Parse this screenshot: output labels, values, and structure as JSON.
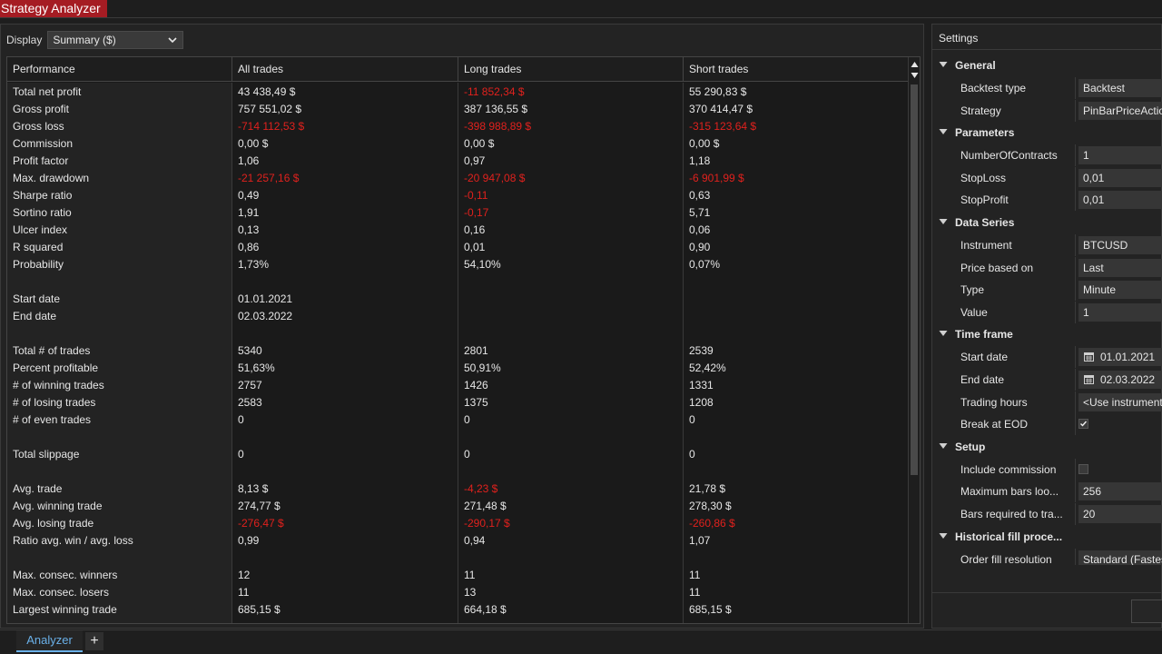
{
  "window": {
    "title": "Strategy Analyzer"
  },
  "display": {
    "label": "Display",
    "selected": "Summary ($)"
  },
  "table": {
    "columns": [
      "Performance",
      "All trades",
      "Long trades",
      "Short trades"
    ],
    "rows": [
      {
        "label": "Total net profit",
        "all": "43 438,49 $",
        "long": "-11 852,34 $",
        "short": "55 290,83 $"
      },
      {
        "label": "Gross profit",
        "all": "757 551,02 $",
        "long": "387 136,55 $",
        "short": "370 414,47 $"
      },
      {
        "label": "Gross loss",
        "all": "-714 112,53 $",
        "long": "-398 988,89 $",
        "short": "-315 123,64 $"
      },
      {
        "label": "Commission",
        "all": "0,00 $",
        "long": "0,00 $",
        "short": "0,00 $"
      },
      {
        "label": "Profit factor",
        "all": "1,06",
        "long": "0,97",
        "short": "1,18"
      },
      {
        "label": "Max. drawdown",
        "all": "-21 257,16 $",
        "long": "-20 947,08 $",
        "short": "-6 901,99 $"
      },
      {
        "label": "Sharpe ratio",
        "all": "0,49",
        "long": "-0,11",
        "short": "0,63"
      },
      {
        "label": "Sortino ratio",
        "all": "1,91",
        "long": "-0,17",
        "short": "5,71"
      },
      {
        "label": "Ulcer index",
        "all": "0,13",
        "long": "0,16",
        "short": "0,06"
      },
      {
        "label": "R squared",
        "all": "0,86",
        "long": "0,01",
        "short": "0,90"
      },
      {
        "label": "Probability",
        "all": "1,73%",
        "long": "54,10%",
        "short": "0,07%"
      },
      {
        "label": "",
        "all": "",
        "long": "",
        "short": ""
      },
      {
        "label": "Start date",
        "all": "01.01.2021",
        "long": "",
        "short": ""
      },
      {
        "label": "End date",
        "all": "02.03.2022",
        "long": "",
        "short": ""
      },
      {
        "label": "",
        "all": "",
        "long": "",
        "short": ""
      },
      {
        "label": "Total # of trades",
        "all": "5340",
        "long": "2801",
        "short": "2539"
      },
      {
        "label": "Percent profitable",
        "all": "51,63%",
        "long": "50,91%",
        "short": "52,42%"
      },
      {
        "label": "# of winning trades",
        "all": "2757",
        "long": "1426",
        "short": "1331"
      },
      {
        "label": "# of losing trades",
        "all": "2583",
        "long": "1375",
        "short": "1208"
      },
      {
        "label": "# of even trades",
        "all": "0",
        "long": "0",
        "short": "0"
      },
      {
        "label": "",
        "all": "",
        "long": "",
        "short": ""
      },
      {
        "label": "Total slippage",
        "all": "0",
        "long": "0",
        "short": "0"
      },
      {
        "label": "",
        "all": "",
        "long": "",
        "short": ""
      },
      {
        "label": "Avg. trade",
        "all": "8,13 $",
        "long": "-4,23 $",
        "short": "21,78 $"
      },
      {
        "label": "Avg. winning trade",
        "all": "274,77 $",
        "long": "271,48 $",
        "short": "278,30 $"
      },
      {
        "label": "Avg. losing trade",
        "all": "-276,47 $",
        "long": "-290,17 $",
        "short": "-260,86 $"
      },
      {
        "label": "Ratio avg. win / avg. loss",
        "all": "0,99",
        "long": "0,94",
        "short": "1,07"
      },
      {
        "label": "",
        "all": "",
        "long": "",
        "short": ""
      },
      {
        "label": "Max. consec. winners",
        "all": "12",
        "long": "11",
        "short": "11"
      },
      {
        "label": "Max. consec. losers",
        "all": "11",
        "long": "13",
        "short": "11"
      },
      {
        "label": "Largest winning trade",
        "all": "685,15 $",
        "long": "664,18 $",
        "short": "685,15 $"
      }
    ]
  },
  "settings": {
    "title": "Settings",
    "items": [
      {
        "kind": "category",
        "label": "General"
      },
      {
        "kind": "prop",
        "label": "Backtest type",
        "value": "Backtest"
      },
      {
        "kind": "prop",
        "label": "Strategy",
        "value": "PinBarPriceAction"
      },
      {
        "kind": "category",
        "label": "Parameters"
      },
      {
        "kind": "prop",
        "label": "NumberOfContracts",
        "value": "1"
      },
      {
        "kind": "prop",
        "label": "StopLoss",
        "value": "0,01"
      },
      {
        "kind": "prop",
        "label": "StopProfit",
        "value": "0,01"
      },
      {
        "kind": "category",
        "label": "Data Series"
      },
      {
        "kind": "prop",
        "label": "Instrument",
        "value": "BTCUSD"
      },
      {
        "kind": "prop",
        "label": "Price based on",
        "value": "Last"
      },
      {
        "kind": "prop",
        "label": "Type",
        "value": "Minute"
      },
      {
        "kind": "prop",
        "label": "Value",
        "value": "1"
      },
      {
        "kind": "category",
        "label": "Time frame"
      },
      {
        "kind": "date",
        "label": "Start date",
        "value": "01.01.2021"
      },
      {
        "kind": "date",
        "label": "End date",
        "value": "02.03.2022"
      },
      {
        "kind": "prop",
        "label": "Trading hours",
        "value": "<Use instrument settings>"
      },
      {
        "kind": "check",
        "label": "Break at EOD",
        "checked": true
      },
      {
        "kind": "category",
        "label": "Setup"
      },
      {
        "kind": "check",
        "label": "Include commission",
        "checked": false
      },
      {
        "kind": "prop",
        "label": "Maximum bars loo...",
        "value": "256"
      },
      {
        "kind": "prop",
        "label": "Bars required to tra...",
        "value": "20"
      },
      {
        "kind": "category",
        "label": "Historical fill proce..."
      },
      {
        "kind": "prop",
        "label": "Order fill resolution",
        "value": "Standard (Fastest)"
      }
    ]
  },
  "tabs": {
    "active": "Analyzer",
    "add": "+"
  },
  "colors": {
    "negative": "#e0211d",
    "brand": "#a51c23",
    "accent": "#6ab0e8"
  }
}
